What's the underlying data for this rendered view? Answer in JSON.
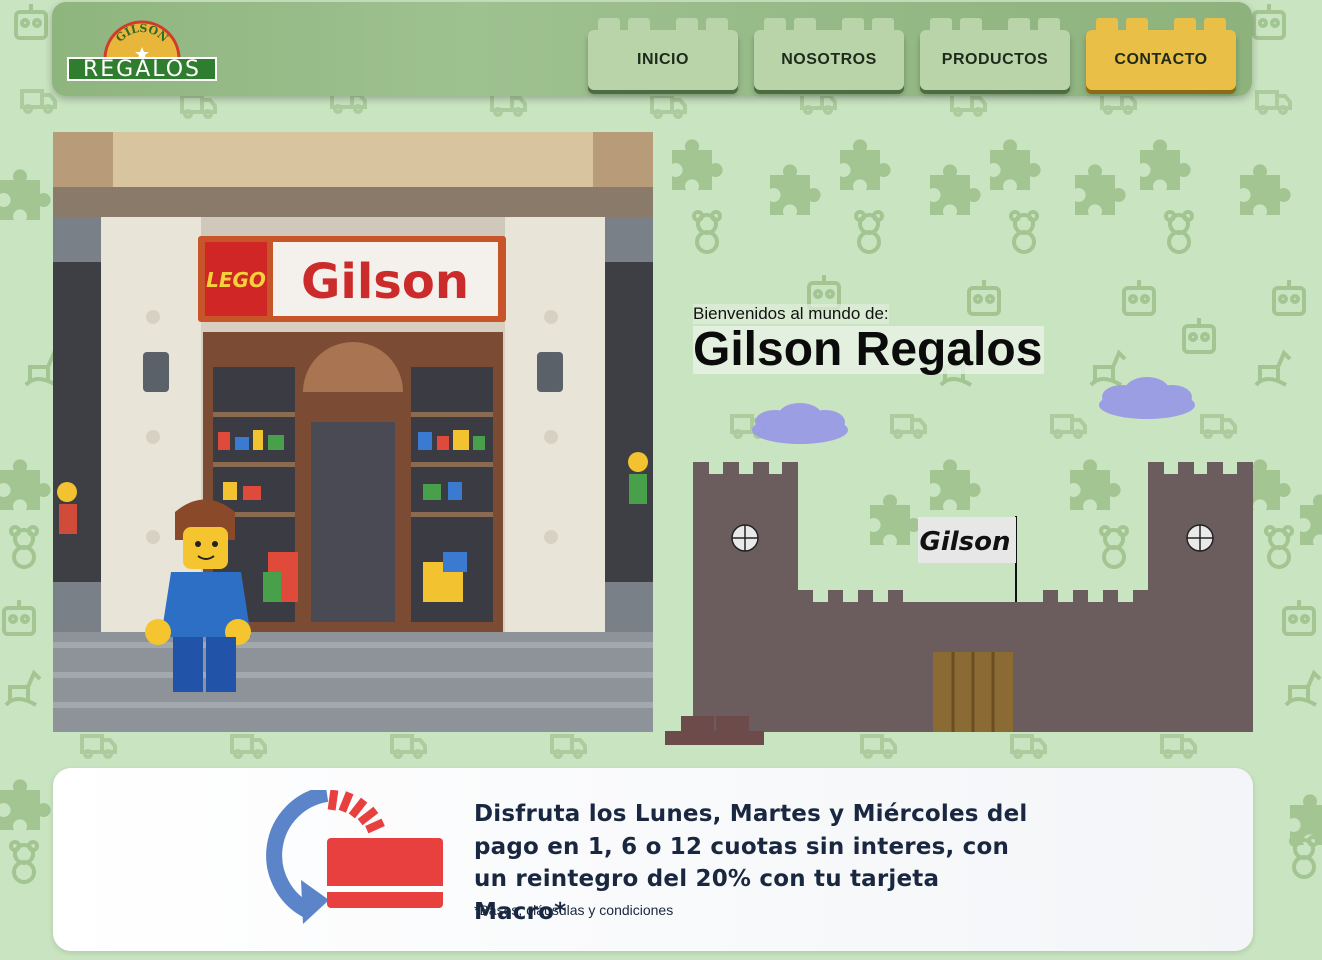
{
  "brand": {
    "logo_arc": "GILSON",
    "logo_word": "REGALOS"
  },
  "nav": {
    "items": [
      {
        "label": "INICIO"
      },
      {
        "label": "NOSOTROS"
      },
      {
        "label": "PRODUCTOS"
      },
      {
        "label": "CONTACTO",
        "active": true
      }
    ]
  },
  "hero": {
    "welcome": "Bienvenidos al mundo de:",
    "title": "Gilson Regalos",
    "store_sign": "Gilson",
    "store_logo": "LEGO",
    "flag_label": "Gilson"
  },
  "promo": {
    "text": "Disfruta los Lunes, Martes y Miércoles del pago en 1, 6 o 12 cuotas sin interes, con un reintegro del 20% con tu tarjeta Macro*",
    "note": "*Bases, cláusulas y condiciones",
    "icon": "card-installments-icon"
  },
  "colors": {
    "background": "#c9e4c0",
    "header": "#9ec190",
    "nav_button": "#b8d4a8",
    "nav_active": "#e9bf47",
    "castle": "#6b5d5d",
    "promo_card": "#e8403f",
    "promo_arrow": "#5b84c9"
  }
}
